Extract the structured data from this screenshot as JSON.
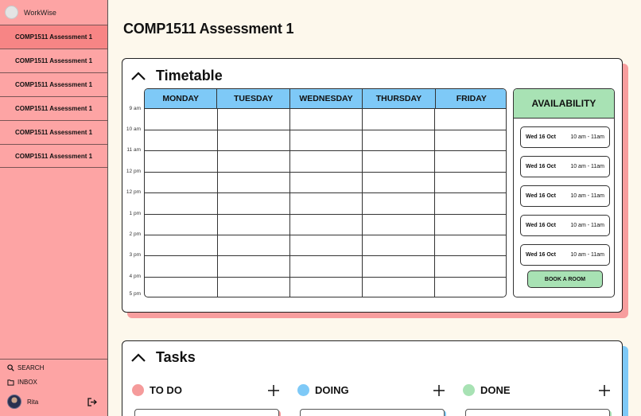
{
  "app": {
    "name": "WorkWise"
  },
  "sidebar": {
    "items": [
      {
        "label": "COMP1511 Assessment 1",
        "active": true
      },
      {
        "label": "COMP1511 Assessment 1",
        "active": false
      },
      {
        "label": "COMP1511 Assessment 1",
        "active": false
      },
      {
        "label": "COMP1511 Assessment 1",
        "active": false
      },
      {
        "label": "COMP1511 Assessment 1",
        "active": false
      },
      {
        "label": "COMP1511 Assessment 1",
        "active": false
      }
    ],
    "search_label": "SEARCH",
    "inbox_label": "INBOX",
    "user_name": "Rita"
  },
  "page": {
    "title": "COMP1511 Assessment 1"
  },
  "timetable": {
    "title": "Timetable",
    "days": [
      "MONDAY",
      "TUESDAY",
      "WEDNESDAY",
      "THURSDAY",
      "FRIDAY"
    ],
    "times": [
      "9 am",
      "10 am",
      "11 am",
      "12 pm",
      "12 pm",
      "1 pm",
      "2 pm",
      "3 pm",
      "4 pm",
      "5 pm"
    ]
  },
  "availability": {
    "title": "AVAILABILITY",
    "slots": [
      {
        "date": "Wed 16 Oct",
        "time": "10 am - 11am"
      },
      {
        "date": "Wed 16 Oct",
        "time": "10 am - 11am"
      },
      {
        "date": "Wed 16 Oct",
        "time": "10 am - 11am"
      },
      {
        "date": "Wed 16 Oct",
        "time": "10 am - 11am"
      },
      {
        "date": "Wed 16 Oct",
        "time": "10 am - 11am"
      }
    ],
    "book_label": "BOOK A ROOM"
  },
  "tasks": {
    "title": "Tasks",
    "columns": [
      {
        "label": "TO DO",
        "color": "#f59b9b"
      },
      {
        "label": "DOING",
        "color": "#7ec9f7"
      },
      {
        "label": "DONE",
        "color": "#a8e2b4"
      }
    ]
  },
  "colors": {
    "sidebar_bg": "#fda4a4",
    "sidebar_active": "#f78585",
    "page_bg": "#fdf8ec",
    "timetable_header": "#7ec9f7",
    "availability_header": "#a8e2b4",
    "timetable_shadow": "#f79e9e",
    "tasks_shadow": "#7ec9f7"
  },
  "icons": {
    "search": "search-icon",
    "inbox": "inbox-icon",
    "logout": "logout-icon",
    "collapse": "chevron-up-icon",
    "add": "plus-icon"
  }
}
